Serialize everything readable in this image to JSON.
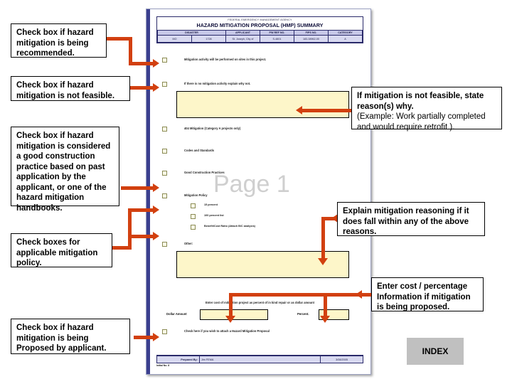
{
  "slide": {
    "watermark": "Page 1",
    "index_button_label": "INDEX"
  },
  "callouts": {
    "recommended": "Check box if hazard mitigation  is being recommended.",
    "not_feasible": "Check box if hazard mitigation is not feasible.",
    "good_practice": "Check box if hazard mitigation is considered a good construction practice based on past application by the applicant, or one of the hazard mitigation handbooks.",
    "policy_boxes": "Check boxes for applicable mitigation policy.",
    "proposed": "Check box if hazard mitigation is being Proposed by applicant.",
    "state_reason_bold": "If mitigation is not feasible, state reason(s) why.",
    "state_reason_regular": "(Example:  Work partially completed and would require retrofit ).",
    "explain_reasoning": "Explain mitigation reasoning if it does fall within any of the above reasons.",
    "enter_cost": "Enter cost / percentage Information if mitigation is being proposed."
  },
  "form": {
    "agency": "FEDERAL EMERGENCY MANAGEMENT AGENCY",
    "title": "HAZARD MITIGATION PROPOSAL (HMP) SUMMARY",
    "meta_headers": [
      "DISASTER",
      "APPLICANT",
      "PW REF NO.",
      "FIPS NO.",
      "CATEGORY"
    ],
    "meta_values": [
      "MO",
      "1728",
      "St. Joseph, City of",
      "S-4801",
      "183-38962-00",
      "A"
    ],
    "rows": [
      "Mitigation activity will be performed on sites in this project.",
      "If there is no mitigation  activity explain why not.",
      "404 Mitigation (Category A projects only)",
      "Codes and Standards",
      "Good Construction Practices",
      "Mitigation Policy"
    ],
    "policy_subrows": [
      "15 percent",
      "100 percent list",
      "Benefit/Cost Ratio (Attach B/C analysis)"
    ],
    "other_label": "Other:",
    "cost_instruction": "Enter cost of mitigation project as percent of in kind repair or as dollar amount",
    "dollar_label": "Dollar Amount",
    "percent_label": "Percent.",
    "attach_row": "Check here if you wish to attach a Hazard Mitigation Proposal",
    "footer_prepared_label": "Prepared By:",
    "footer_prepared_value": "Jim FEMA",
    "footer_date": "3/08/2005",
    "footer_note": "Initial No. 8"
  },
  "colors": {
    "connector": "#D2400F",
    "field_fill": "#fdf6c9",
    "table_fill": "#d8d9f0",
    "index_button": "#c0c0c0"
  }
}
